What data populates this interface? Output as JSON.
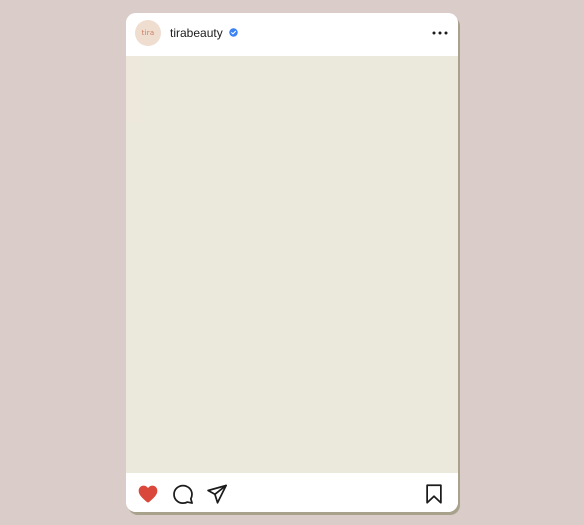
{
  "post": {
    "account": {
      "username": "tirabeauty",
      "avatar_text": "tira",
      "verified": true
    },
    "liked": true,
    "icons": {
      "avatar": "tira-logo-icon",
      "verified": "verified-badge-icon",
      "more": "more-options-icon",
      "like": "heart-filled-icon",
      "comment": "comment-bubble-icon",
      "share": "paper-plane-icon",
      "save": "bookmark-icon"
    },
    "colors": {
      "background": "#dacdc9",
      "card": "#ffffff",
      "image_placeholder": "#ebe8dc",
      "like": "#d9483b",
      "verified": "#3b82f6",
      "avatar_bg": "#efddd0",
      "avatar_text": "#c77e5e"
    }
  }
}
